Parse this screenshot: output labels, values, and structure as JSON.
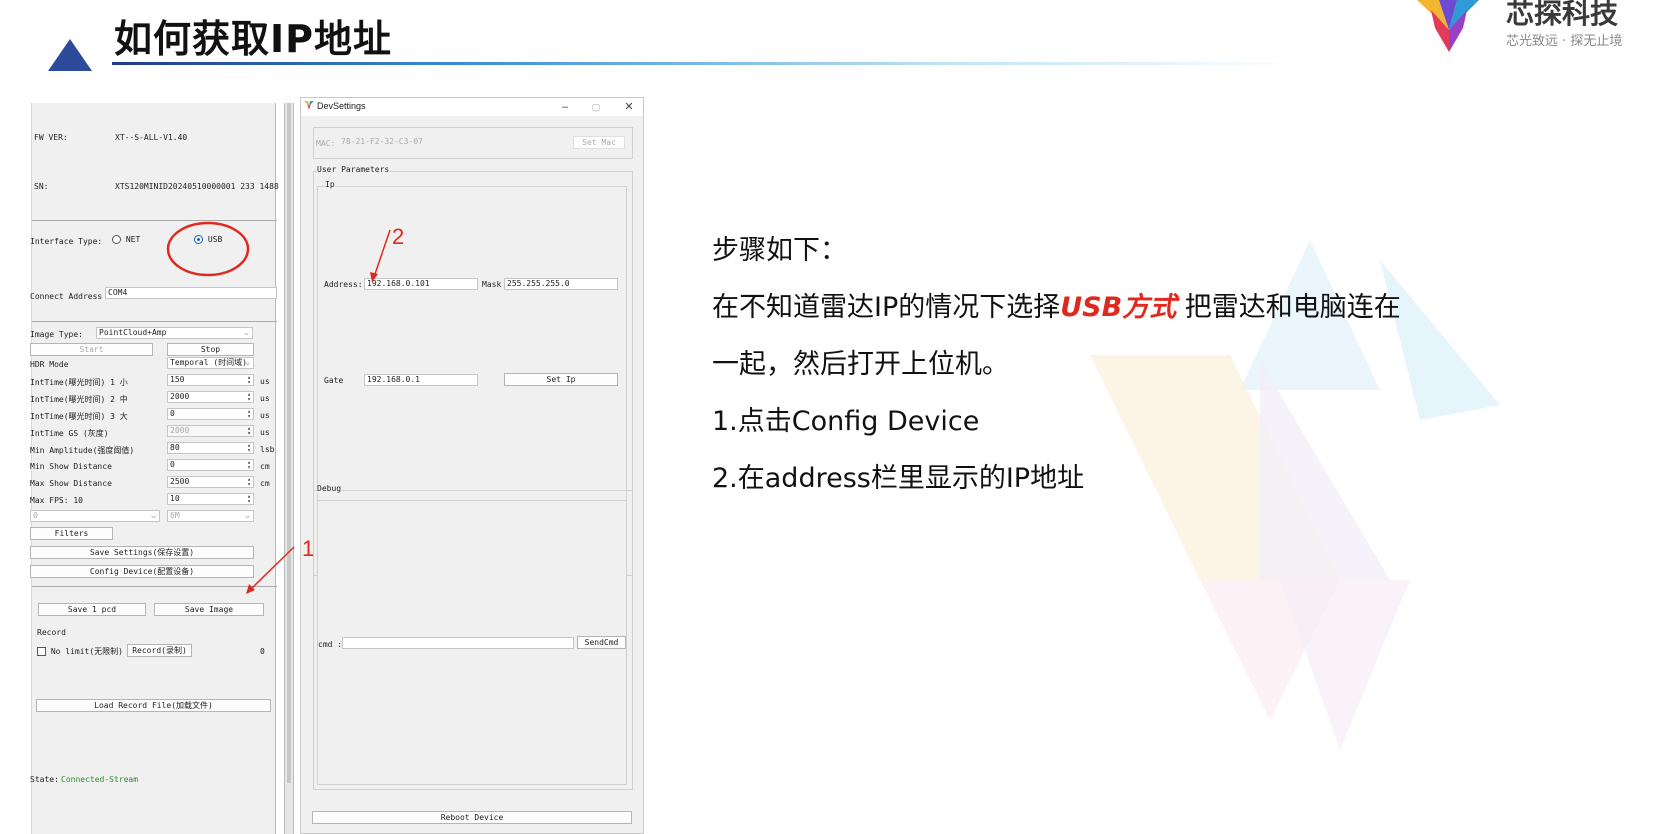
{
  "slide": {
    "title": "如何获取IP地址",
    "brand_name": "芯探科技",
    "brand_tagline": "芯光致远 · 探无止境"
  },
  "app": {
    "fw_label": "FW VER:",
    "fw_value": "XT--S-ALL-V1.40",
    "sn_label": "SN:",
    "sn_value": "XTS120MINID20240510000001 233 1488",
    "interface_label": "Interface Type:",
    "interface_net": "NET",
    "interface_usb": "USB",
    "connect_label": "Connect Address :",
    "connect_value": "COM4",
    "image_type_label": "Image Type:",
    "image_type_value": "PointCloud+Amp",
    "start_label": "Start",
    "stop_label": "Stop",
    "hdr_label": "HDR Mode",
    "hdr_value": "Temporal (时间域)",
    "int1_label": "IntTime(曝光时间) 1 小",
    "int1_value": "150",
    "int2_label": "IntTime(曝光时间) 2 中",
    "int2_value": "2000",
    "int3_label": "IntTime(曝光时间) 3 大",
    "int3_value": "0",
    "intgs_label": "IntTime GS (灰度)",
    "intgs_value": "2000",
    "minamp_label": "Min Amplitude(强度阈值)",
    "minamp_value": "80",
    "minshow_label": "Min Show Distance",
    "minshow_value": "0",
    "maxshow_label": "Max Show Distance",
    "maxshow_value": "2500",
    "maxfps_label": "Max FPS: 10",
    "maxfps_value": "10",
    "combo_a": "0",
    "combo_b": "6M",
    "unit_us": "us",
    "unit_lsb": "lsb",
    "unit_cm": "cm",
    "filters_label": "Filters",
    "save_settings_label": "Save Settings(保存设置)",
    "config_device_label": "Config Device(配置设备)",
    "save_pcd_label": "Save 1 pcd",
    "save_image_label": "Save Image",
    "record_group_label": "Record",
    "no_limit_label": "No limit(无限制)",
    "record_btn_label": "Record(录制)",
    "record_count": "0",
    "load_record_label": "Load Record File(加载文件)",
    "state_label": "State:",
    "state_value": "Connected-Stream"
  },
  "dev": {
    "window_title": "DevSettings",
    "mac_label": "MAC:",
    "mac_value": "78-21-F2-32-C3-07",
    "set_mac_label": "Set Mac",
    "user_params_label": "User Parameters",
    "ip_group_label": "Ip",
    "address_label": "Address:",
    "address_value": "192.168.0.101",
    "mask_label": "Mask",
    "mask_value": "255.255.255.0",
    "gate_label": "Gate",
    "gate_value": "192.168.0.1",
    "set_ip_label": "Set Ip",
    "debug_label": "Debug",
    "cmd_label": "cmd :",
    "cmd_value": "",
    "send_cmd_label": "SendCmd",
    "reboot_label": "Reboot Device"
  },
  "annotations": {
    "marker_1": "1",
    "marker_2": "2"
  },
  "steps": {
    "heading": "步骤如下：",
    "line1_pre": "在不知道雷达IP的情况下选择",
    "line1_highlight": "USB方式",
    "line1_post": " 把雷达和电脑连在",
    "line2": "一起，然后打开上位机。",
    "step1": "1.点击Config Device",
    "step2": "2.在address栏里显示的IP地址"
  },
  "colors": {
    "accent_red": "#e0291e",
    "title_triangle": "#2e4a9b",
    "state_green": "#2e8b2e"
  }
}
